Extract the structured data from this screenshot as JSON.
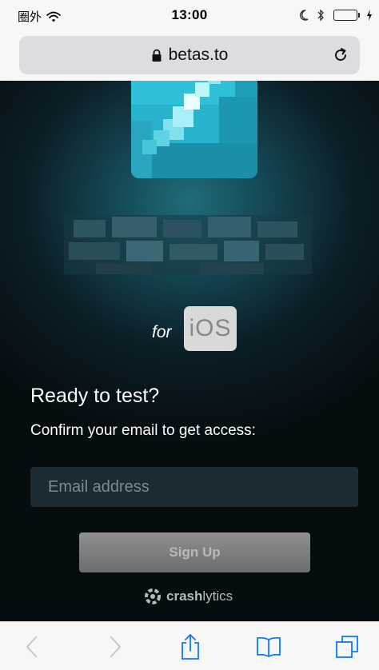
{
  "status_bar": {
    "carrier": "圈外",
    "time": "13:00"
  },
  "browser": {
    "url": "betas.to"
  },
  "page": {
    "for_text": "for",
    "platform_badge": "iOS",
    "headline": "Ready to test?",
    "subtitle": "Confirm your email to get access:",
    "email_placeholder": "Email address",
    "signup_label": "Sign Up",
    "brand_bold": "crash",
    "brand_light": "lytics"
  },
  "icons": {
    "status": [
      "wifi-icon",
      "moon-icon",
      "bluetooth-icon",
      "battery-icon",
      "charging-icon"
    ],
    "url_bar": [
      "lock-icon",
      "reload-icon"
    ],
    "toolbar": [
      "back-icon",
      "forward-icon",
      "share-icon",
      "bookmarks-icon",
      "tabs-icon"
    ]
  },
  "colors": {
    "battery_fill": "#4cd964",
    "toolbar_tint": "#0a7aff",
    "page_bg": "#0b1e26"
  }
}
